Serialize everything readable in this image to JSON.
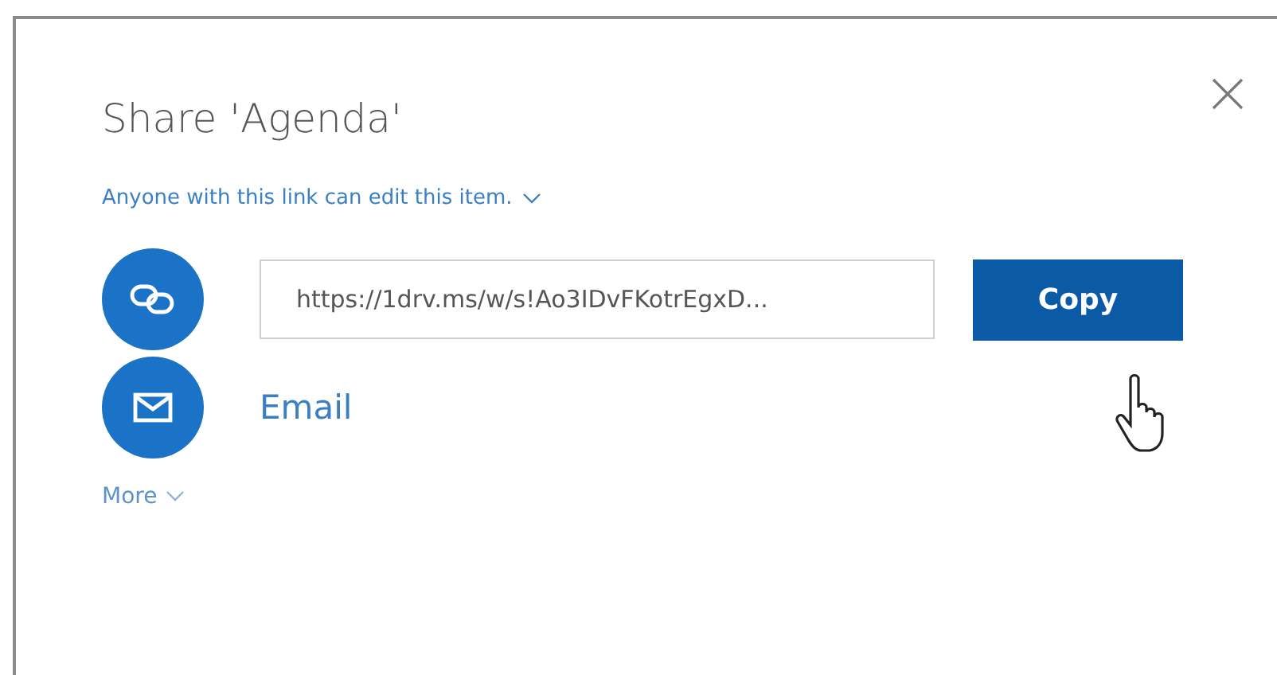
{
  "dialog": {
    "title": "Share 'Agenda'",
    "permission": "Anyone with this link can edit this item.",
    "link": "https://1drv.ms/w/s!Ao3IDvFKotrEgxD...",
    "copy_button": "Copy",
    "email": "Email",
    "more": "More"
  }
}
